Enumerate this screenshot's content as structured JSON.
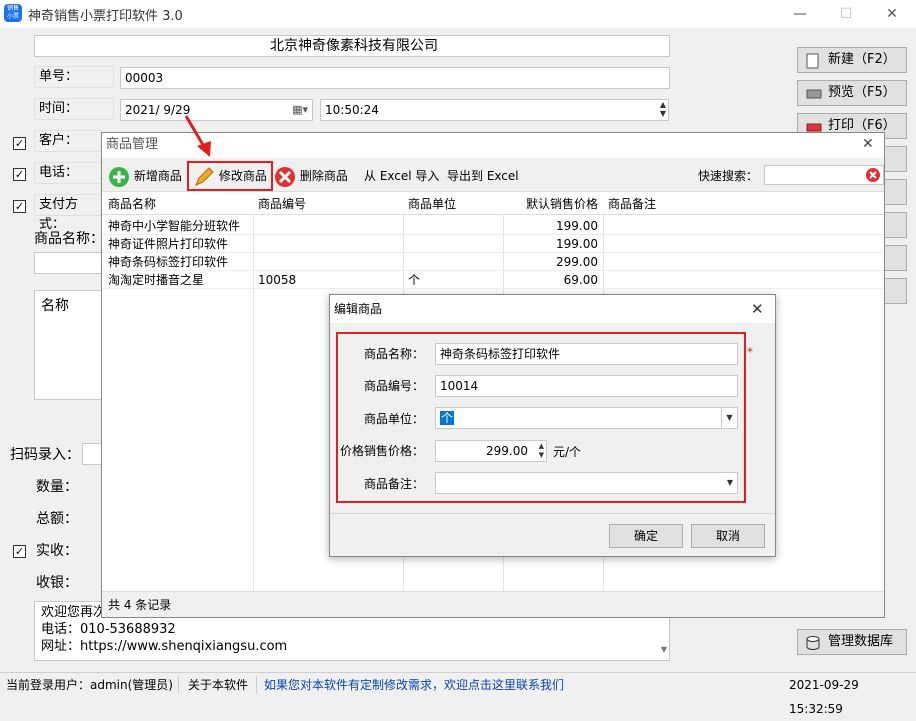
{
  "window": {
    "title": "神奇销售小票打印软件 3.0",
    "icon_text": "销售\n小票",
    "minimize": "—",
    "maximize": "☐",
    "close": "✕"
  },
  "form": {
    "company": "北京神奇像素科技有限公司",
    "order_no_label": "单号：",
    "order_no": "00003",
    "time_label": "时间：",
    "date": "2021/ 9/29",
    "time": "10:50:24",
    "customer_label": "客户：",
    "phone_label": "电话：",
    "payment_label": "支付方式：",
    "product_name_label": "商品名称：",
    "name_header": "名称",
    "scan_label": "扫码录入：",
    "qty_label": "数量：",
    "total_label": "总额：",
    "paid_label": "实收：",
    "cashier_label": "收银：",
    "footer_text": [
      "欢迎您再次光临！",
      "电话：010-53688932",
      "网址：https://www.shenqixiangsu.com"
    ]
  },
  "sidebar": {
    "new": "新建（F2）",
    "preview": "预览（F5）",
    "print": "打印（F6）",
    "db": "管理数据库"
  },
  "product_window": {
    "title": "商品管理",
    "toolbar": {
      "add": "新增商品",
      "edit": "修改商品",
      "delete": "删除商品",
      "import": "从 Excel 导入",
      "export": "导出到 Excel",
      "search_label": "快速搜索："
    },
    "columns": [
      "商品名称",
      "商品编号",
      "商品单位",
      "默认销售价格",
      "商品备注"
    ],
    "rows": [
      [
        "神奇中小学智能分班软件",
        "",
        "",
        "199.00",
        ""
      ],
      [
        "神奇证件照片打印软件",
        "",
        "",
        "199.00",
        ""
      ],
      [
        "神奇条码标签打印软件",
        "",
        "",
        "299.00",
        ""
      ],
      [
        "淘淘定时播音之星",
        "10058",
        "个",
        "69.00",
        ""
      ]
    ],
    "status": "共 4 条记录"
  },
  "edit_dialog": {
    "title": "编辑商品",
    "name_label": "商品名称：",
    "name_value": "神奇条码标签打印软件",
    "required_mark": "*",
    "code_label": "商品编号：",
    "code_value": "10014",
    "unit_label": "商品单位：",
    "unit_value": "个",
    "price_label": "价格销售价格：",
    "price_value": "299.00",
    "price_unit": "元/个",
    "note_label": "商品备注：",
    "note_value": "",
    "ok": "确定",
    "cancel": "取消"
  },
  "bottombar": {
    "user": "当前登录用户：admin(管理员)",
    "about": "关于本软件",
    "link": "如果您对本软件有定制修改需求，欢迎点击这里联系我们",
    "datetime": "2021-09-29 15:32:59"
  },
  "colors": {
    "highlight_red": "#e02020",
    "link_blue": "#0645ad",
    "selection_blue": "#0078d7"
  }
}
